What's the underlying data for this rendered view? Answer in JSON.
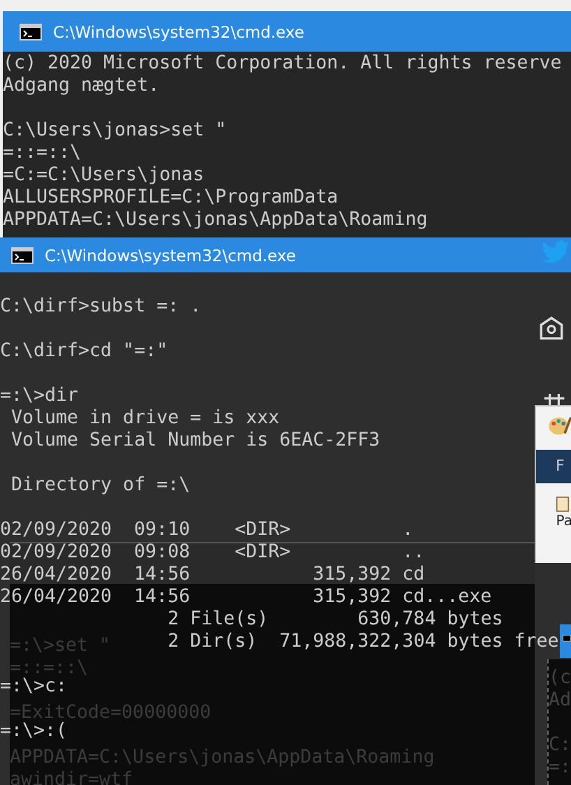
{
  "back_window": {
    "title": "C:\\Windows\\system32\\cmd.exe",
    "lines": [
      {
        "text": "(c) 2020 Microsoft Corporation. All rights reserve",
        "blank_before": false
      },
      {
        "text": "Adgang nægtet.",
        "blank_before": false
      },
      {
        "text": "C:\\Users\\jonas>set \"",
        "blank_before": true
      },
      {
        "text": "=::=::\\",
        "blank_before": false
      },
      {
        "text": "=C:=C:\\Users\\jonas",
        "blank_before": false
      },
      {
        "text": "ALLUSERSPROFILE=C:\\ProgramData",
        "blank_before": false
      },
      {
        "text": "APPDATA=C:\\Users\\jonas\\AppData\\Roaming",
        "blank_before": false
      }
    ]
  },
  "front_window": {
    "title": "C:\\Windows\\system32\\cmd.exe",
    "lines": [
      {
        "text": "C:\\dirf>subst =: .",
        "blank_before": true
      },
      {
        "text": "C:\\dirf>cd \"=:\"",
        "blank_before": true
      },
      {
        "text": "=:\\>dir",
        "blank_before": true
      },
      {
        "text": " Volume in drive = is xxx",
        "blank_before": false
      },
      {
        "text": " Volume Serial Number is 6EAC-2FF3",
        "blank_before": false
      },
      {
        "text": " Directory of =:\\",
        "blank_before": true
      }
    ],
    "listing": [
      {
        "date": "02/09/2020",
        "time": "09:10",
        "type": "<DIR>",
        "name": "."
      },
      {
        "date": "02/09/2020",
        "time": "09:08",
        "type": "<DIR>",
        "name": ".."
      },
      {
        "date": "26/04/2020",
        "time": "14:56",
        "size": "315,392",
        "name": "cd"
      },
      {
        "date": "26/04/2020",
        "time": "14:56",
        "size": "315,392",
        "name": "cd...exe"
      }
    ],
    "summary": [
      {
        "count": "2 File(s)",
        "amount": "630,784",
        "unit": "bytes"
      },
      {
        "count": "2 Dir(s)",
        "amount": "71,988,322,304",
        "unit": "bytes free"
      }
    ],
    "after_lines": [
      "=:\\>c:",
      "=:\\>:("
    ]
  },
  "ghost_window": {
    "blocks": [
      [
        "=:\\>set \"",
        "=::=::\\"
      ],
      [
        "=ExitCode=00000000"
      ],
      [
        "APPDATA=C:\\Users\\jonas\\AppData\\Roaming",
        "awindir=wtf"
      ]
    ]
  },
  "side_panel": {
    "tab": "F",
    "label": "Pa"
  },
  "side_window": {
    "blocks": [
      [
        "(c",
        "Ad"
      ],
      [
        "C:",
        "=:"
      ]
    ]
  }
}
